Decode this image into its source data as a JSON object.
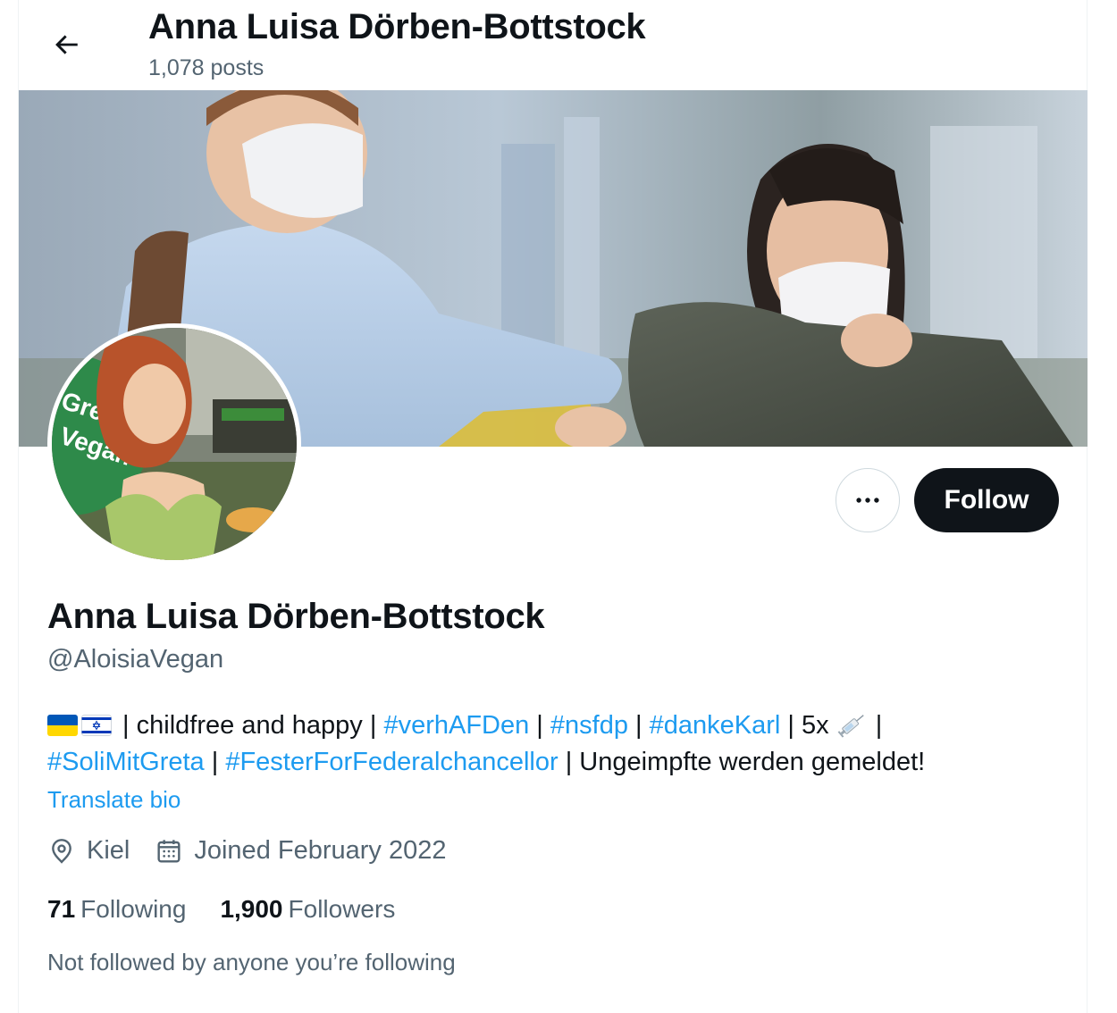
{
  "header": {
    "title": "Anna Luisa Dörben-Bottstock",
    "posts_count": "1,078 posts"
  },
  "avatar": {
    "sign_text_line1": "Green",
    "sign_text_line2": "Vegan"
  },
  "actions": {
    "follow_label": "Follow",
    "more_icon": "more-horizontal-icon"
  },
  "profile": {
    "display_name": "Anna Luisa Dörben-Bottstock",
    "handle": "@AloisiaVegan",
    "bio": {
      "flags": [
        "ukraine-flag",
        "israel-flag"
      ],
      "sep1": " |  ",
      "text1": "childfree and happy | ",
      "tag1": "#verhAFDen",
      "sep2": " | ",
      "tag2": "#nsfdp",
      "sep3": " | ",
      "tag3": "#dankeKarl",
      "text2": " | 5x ",
      "syringe_icon": "syringe-icon",
      "sep4": " |",
      "tag4": "#SoliMitGreta",
      "sep5": " | ",
      "tag5": "#FesterForFederalchancellor",
      "text3": " | Ungeimpfte werden gemeldet!"
    },
    "translate_label": "Translate bio",
    "location": "Kiel",
    "joined": "Joined February 2022",
    "following_count": "71",
    "following_label": "Following",
    "followers_count": "1,900",
    "followers_label": "Followers",
    "not_followed": "Not followed by anyone you’re following"
  },
  "colors": {
    "accent": "#1d9bf0",
    "text": "#0f1419",
    "secondary": "#536471",
    "border": "#cfd9de"
  }
}
